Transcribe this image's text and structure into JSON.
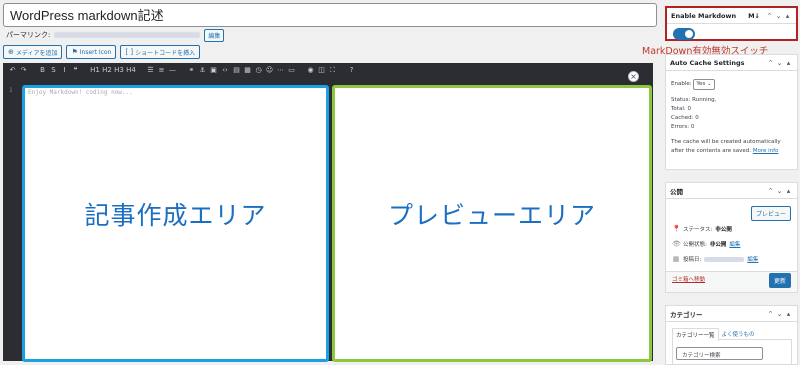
{
  "post": {
    "title": "WordPress markdown記述",
    "permalink_label": "パーマリンク:",
    "permalink_edit": "編集"
  },
  "media_buttons": [
    {
      "icon": "media-icon",
      "glyph": "⊕",
      "label": "メディアを追加"
    },
    {
      "icon": "flag-icon",
      "glyph": "⚑",
      "label": "Insert Icon"
    },
    {
      "icon": "shortcode-icon",
      "glyph": "[ ]",
      "label": "ショートコードを挿入"
    }
  ],
  "toolbar": {
    "buttons": [
      {
        "name": "undo-icon",
        "glyph": "↶"
      },
      {
        "name": "redo-icon",
        "glyph": "↷"
      },
      {
        "name": "gap"
      },
      {
        "name": "bold-icon",
        "glyph": "B"
      },
      {
        "name": "strike-icon",
        "glyph": "S"
      },
      {
        "name": "italic-icon",
        "glyph": "I"
      },
      {
        "name": "quote-icon",
        "glyph": "❝"
      },
      {
        "name": "gap"
      },
      {
        "name": "h1-button",
        "glyph": "H1"
      },
      {
        "name": "h2-button",
        "glyph": "H2"
      },
      {
        "name": "h3-button",
        "glyph": "H3"
      },
      {
        "name": "h4-button",
        "glyph": "H4"
      },
      {
        "name": "gap"
      },
      {
        "name": "unordered-list-icon",
        "glyph": "☰"
      },
      {
        "name": "ordered-list-icon",
        "glyph": "≡"
      },
      {
        "name": "hr-icon",
        "glyph": "—"
      },
      {
        "name": "gap"
      },
      {
        "name": "link-icon",
        "glyph": "⚭"
      },
      {
        "name": "anchor-icon",
        "glyph": "⚓"
      },
      {
        "name": "image-icon",
        "glyph": "▣"
      },
      {
        "name": "code-icon",
        "glyph": "‹›"
      },
      {
        "name": "code-block-icon",
        "glyph": "▤"
      },
      {
        "name": "table-icon",
        "glyph": "▦"
      },
      {
        "name": "clock-icon",
        "glyph": "◷"
      },
      {
        "name": "emoji-icon",
        "glyph": "☺"
      },
      {
        "name": "more-icon",
        "glyph": "⋯"
      },
      {
        "name": "special-icon",
        "glyph": "▭"
      },
      {
        "name": "gap"
      },
      {
        "name": "watch-icon",
        "glyph": "◉"
      },
      {
        "name": "preview-icon",
        "glyph": "◫"
      },
      {
        "name": "fullscreen-icon",
        "glyph": "⛶"
      },
      {
        "name": "gap"
      },
      {
        "name": "help-icon",
        "glyph": "?"
      }
    ]
  },
  "editor": {
    "line_number": "1",
    "placeholder": "Enjoy Markdown! coding now...",
    "edit_area_label": "記事作成エリア",
    "preview_area_label": "プレビューエリア"
  },
  "markdown_box": {
    "title": "Enable Markdown",
    "badge": "M↓",
    "enabled": true,
    "note": "MarkDown有効無効スイッチ"
  },
  "cache_box": {
    "title": "Auto Cache Settings",
    "enable_label": "Enable:",
    "enable_value": "Yes",
    "status": "Status: Running,",
    "total": "Total: 0",
    "cached": "Cached: 0",
    "errors": "Errors: 0",
    "desc": "The cache will be created automatically after the contents are saved.",
    "more": "More info"
  },
  "publish_box": {
    "title": "公開",
    "preview_button": "プレビュー",
    "status_label": "ステータス:",
    "status_value": "非公開",
    "visibility_label": "公開状態:",
    "visibility_value": "非公開",
    "visibility_edit": "編集",
    "date_label": "投稿日:",
    "date_edit": "編集",
    "trash": "ゴミ箱へ移動",
    "update": "更新"
  },
  "category_box": {
    "title": "カテゴリー",
    "tab_all": "カテゴリー一覧",
    "tab_popular": "よく使うもの",
    "search_placeholder": "カテゴリー検索"
  },
  "colors": {
    "edit_border": "#1ba1e2",
    "preview_border": "#8dc63f",
    "area_label": "#1b6fc2",
    "markdown_highlight": "#b22222",
    "primary": "#2271b1"
  }
}
